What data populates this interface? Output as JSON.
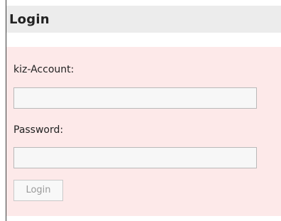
{
  "login_panel": {
    "title": "Login",
    "account_label": "kiz-Account:",
    "account_value": "",
    "password_label": "Password:",
    "password_value": "",
    "submit_label": "Login"
  },
  "colors": {
    "header_bg": "#ececec",
    "body_bg": "#fde9e9",
    "button_text": "#9a9a9a"
  }
}
